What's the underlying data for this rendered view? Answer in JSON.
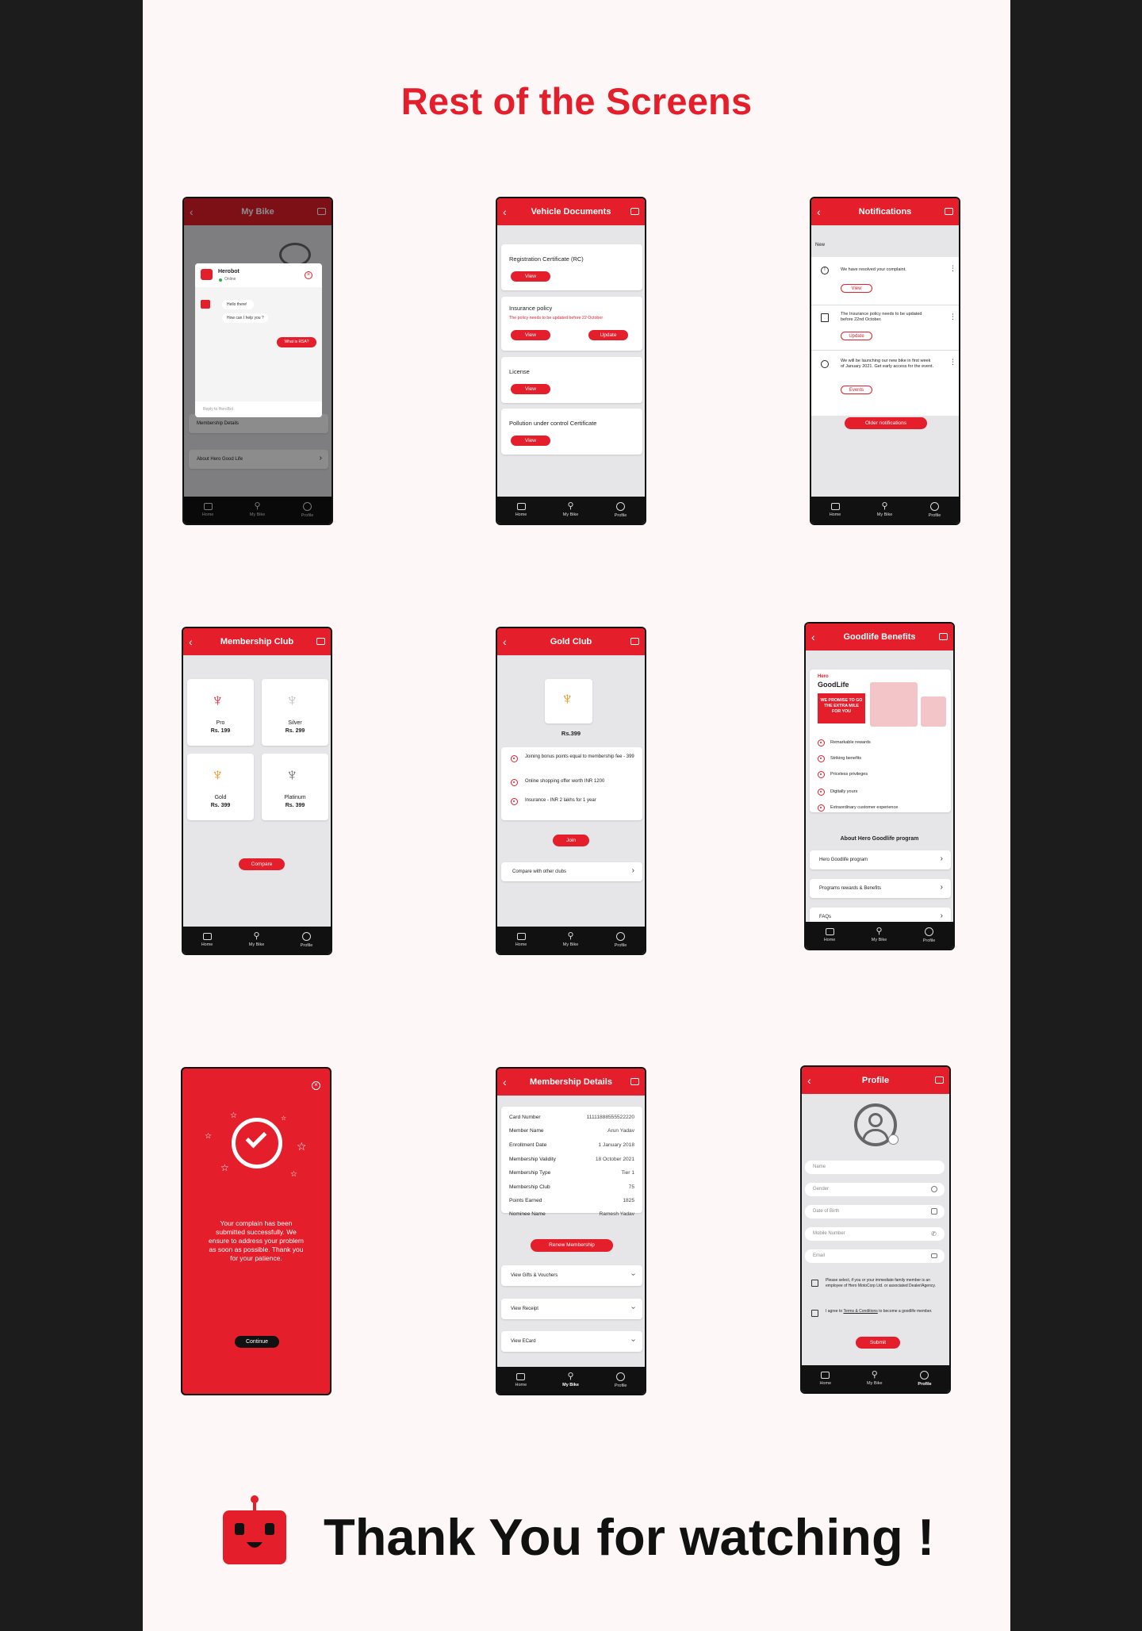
{
  "page": {
    "title": "Rest of the Screens",
    "footer": "Thank You for watching !"
  },
  "colors": {
    "brand_red": "#e41e2b",
    "bg": "#fdf7f7",
    "dark": "#111111"
  },
  "nav": {
    "home": "Home",
    "bike": "My Bike",
    "profile": "Profile"
  },
  "s1": {
    "title": "My Bike",
    "bot_name": "Herobot",
    "status": "Online",
    "msg1": "Hello there!",
    "msg2": "How can I help you ?",
    "user_msg": "What is RSA?",
    "reply_placeholder": "Reply to HeroBot",
    "row1": "Membership Details",
    "row2": "About Hero Good Life"
  },
  "s2": {
    "title": "Vehicle Documents",
    "doc1": "Registration Certificate (RC)",
    "doc2": "Insurance policy",
    "doc2_note": "The policy needs to be updated before 22 October",
    "doc3": "License",
    "doc4": "Pollution under control Certificate",
    "view": "View",
    "update": "Update"
  },
  "s3": {
    "title": "Notifications",
    "section": "New",
    "n1": "We have resolved your complaint.",
    "n1_btn": "View",
    "n2": "The Insurance policy needs to be updated before 22nd October.",
    "n2_btn": "Update",
    "n3": "We will be launching our new bike in first week of January 2021. Get early access for the event.",
    "n3_btn": "Events",
    "older": "Older notifications"
  },
  "s4": {
    "title": "Membership Club",
    "pro": "Pro",
    "pro_price": "Rs. 199",
    "silver": "Silver",
    "silver_price": "Rs. 299",
    "gold": "Gold",
    "gold_price": "Rs. 399",
    "platinum": "Platinum",
    "platinum_price": "Rs. 399",
    "compare": "Compare"
  },
  "s5": {
    "title": "Gold Club",
    "price": "Rs.399",
    "b1": "Joining bonus points equal to membership fee - 399",
    "b2": "Online shopping offer worth INR 1200",
    "b3": "Insurance - INR 2 lakhs for 1 year",
    "join": "Join",
    "compare": "Compare with other clubs"
  },
  "s6": {
    "title": "Goodlife Benefits",
    "brand1": "Hero",
    "brand2": "GoodLife",
    "promise": "WE PROMISE TO GO THE EXTRA MILE FOR YOU",
    "f1": "Remarkable rewards",
    "f2": "Striking benefits",
    "f3": "Priceless privileges",
    "f4": "Digitally yours",
    "f5": "Extraordinary customer experience",
    "about": "About Hero Goodlife program",
    "link1": "Hero Goodlife program",
    "link2": "Programs rewards & Benefits",
    "link3": "FAQs"
  },
  "s7": {
    "message": "Your complain has been submitted successfully. We ensure to address your problem as soon as possible. Thank you for your patience.",
    "continue": "Continue"
  },
  "s8": {
    "title": "Membership Details",
    "rows": [
      [
        "Card Number",
        "11111888555522220"
      ],
      [
        "Member Name",
        "Arun Yadav"
      ],
      [
        "Enrollment Date",
        "1 January 2018"
      ],
      [
        "Membership Validity",
        "18 October 2021"
      ],
      [
        "Membership Type",
        "Tier 1"
      ],
      [
        "Membership Club",
        "75"
      ],
      [
        "Points Earned",
        "1825"
      ],
      [
        "Nominee Name",
        "Ramesh Yadav"
      ]
    ],
    "renew": "Renew Membership",
    "acc1": "View Gifts & Vouchers",
    "acc2": "View Receipt",
    "acc3": "View ECard"
  },
  "s9": {
    "title": "Profile",
    "name": "Name",
    "gender": "Gender",
    "dob": "Date of Birth",
    "mobile": "Mobile Number",
    "email": "Email",
    "c1": "Please select, if you or your immediate family member is an employee of Hero MotoCorp Ltd. or associated Dealer/Agency.",
    "c2a": "I agree to ",
    "c2b": "Terms & Conditions",
    "c2c": " to become a goodlife member.",
    "submit": "Submit"
  }
}
